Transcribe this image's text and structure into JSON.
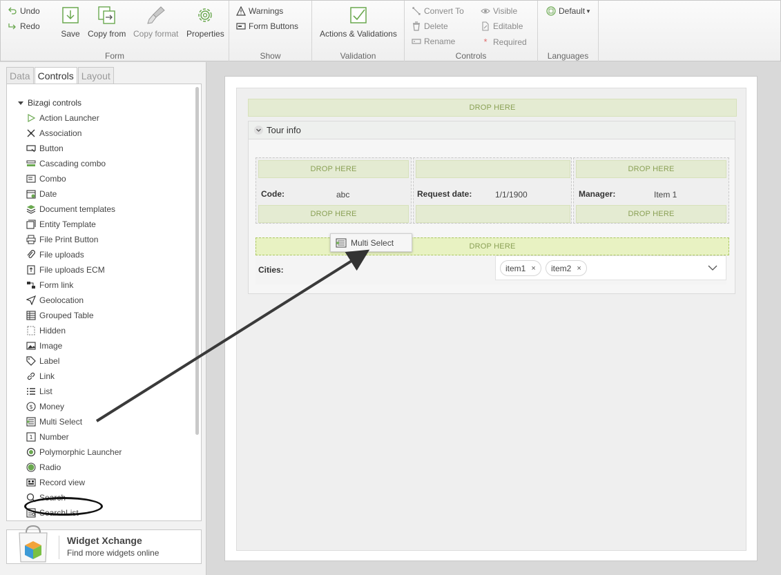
{
  "ribbon": {
    "undo": "Undo",
    "redo": "Redo",
    "save": "Save",
    "copy_from": "Copy from",
    "copy_format": "Copy format",
    "properties": "Properties",
    "form_group": "Form",
    "warnings": "Warnings",
    "form_buttons": "Form Buttons",
    "show_group": "Show",
    "actions_validations": "Actions & Validations",
    "validation_group": "Validation",
    "convert_to": "Convert To",
    "delete": "Delete",
    "rename": "Rename",
    "visible": "Visible",
    "editable": "Editable",
    "required": "Required",
    "controls_group": "Controls",
    "language_default": "Default",
    "languages_group": "Languages"
  },
  "left_panel": {
    "tabs": [
      "Data",
      "Controls",
      "Layout"
    ],
    "active_tab": "Controls",
    "tree_root": "Bizagi controls",
    "controls": [
      {
        "label": "Action Launcher",
        "icon": "play-outline-icon"
      },
      {
        "label": "Association",
        "icon": "association-icon"
      },
      {
        "label": "Button",
        "icon": "button-icon"
      },
      {
        "label": "Cascading combo",
        "icon": "cascading-combo-icon"
      },
      {
        "label": "Combo",
        "icon": "combo-icon"
      },
      {
        "label": "Date",
        "icon": "calendar-icon"
      },
      {
        "label": "Document templates",
        "icon": "document-templates-icon"
      },
      {
        "label": "Entity Template",
        "icon": "entity-template-icon"
      },
      {
        "label": "File Print Button",
        "icon": "printer-icon"
      },
      {
        "label": "File uploads",
        "icon": "paperclip-icon"
      },
      {
        "label": "File uploads ECM",
        "icon": "file-upload-ecm-icon"
      },
      {
        "label": "Form link",
        "icon": "form-link-icon"
      },
      {
        "label": "Geolocation",
        "icon": "geolocation-icon"
      },
      {
        "label": "Grouped Table",
        "icon": "grouped-table-icon"
      },
      {
        "label": "Hidden",
        "icon": "hidden-icon"
      },
      {
        "label": "Image",
        "icon": "image-icon"
      },
      {
        "label": "Label",
        "icon": "tag-icon"
      },
      {
        "label": "Link",
        "icon": "link-icon"
      },
      {
        "label": "List",
        "icon": "list-icon"
      },
      {
        "label": "Money",
        "icon": "money-icon"
      },
      {
        "label": "Multi Select",
        "icon": "multi-select-icon"
      },
      {
        "label": "Number",
        "icon": "number-icon"
      },
      {
        "label": "Polymorphic Launcher",
        "icon": "polymorphic-launcher-icon"
      },
      {
        "label": "Radio",
        "icon": "radio-icon"
      },
      {
        "label": "Record view",
        "icon": "record-view-icon"
      },
      {
        "label": "Search",
        "icon": "search-icon"
      },
      {
        "label": "SearchList",
        "icon": "search-list-icon"
      }
    ],
    "widget_title": "Widget Xchange",
    "widget_subtitle": "Find more widgets online"
  },
  "form": {
    "drop_here": "DROP HERE",
    "group_title": "Tour info",
    "fields": [
      {
        "label": "Code:",
        "value": "abc"
      },
      {
        "label": "Request date:",
        "value": "1/1/1900"
      },
      {
        "label": "Manager:",
        "value": "Item 1"
      }
    ],
    "cities_label": "Cities:",
    "chips": [
      "item1",
      "item2"
    ],
    "chip_remove": "×",
    "drag_ghost_label": "Multi Select"
  },
  "colors": {
    "drop_zone_bg": "#e4ebd2",
    "drop_zone_text": "#8aa055",
    "active_drop_border": "#aac75e"
  }
}
